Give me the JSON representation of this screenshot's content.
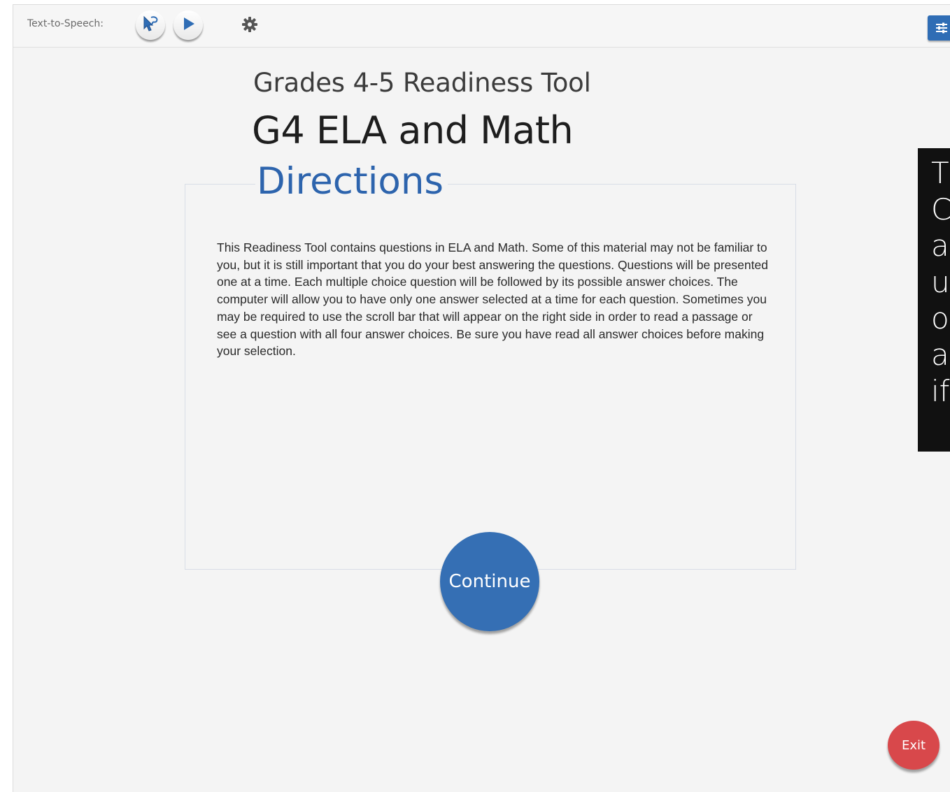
{
  "toolbar": {
    "tts_label": "Text-to-Speech:",
    "icons": {
      "select": "speak-selection-icon",
      "play": "play-icon",
      "settings": "gear-icon",
      "menu": "sliders-icon"
    }
  },
  "header": {
    "subtitle": "Grades 4-5 Readiness Tool",
    "title": "G4 ELA and Math"
  },
  "directions": {
    "heading": "Directions",
    "body": "This Readiness Tool contains questions in ELA and Math. Some of this material may not be familiar to you, but it is still important that you do your best answering the questions. Questions will be presented one at a time. Each multiple choice question will be followed by its possible answer choices. The computer will allow you to have only one answer selected at a time for each question. Sometimes you may be required to use the scroll bar that will appear on the right side in order to read a passage or see a question with all four answer choices. Be sure you have read all answer choices before making your selection."
  },
  "continue_label": "Continue",
  "exit_label": "Exit",
  "side_panel": {
    "lines": [
      "T",
      "C",
      "al",
      "u",
      "o",
      "a",
      "if"
    ]
  },
  "colors": {
    "accent_blue": "#356fb4",
    "heading_blue": "#2d64ad",
    "exit_red": "#d8484b",
    "panel_dark": "#111111"
  }
}
